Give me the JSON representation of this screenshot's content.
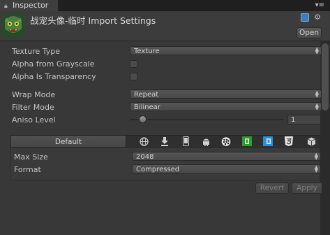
{
  "window": {
    "tab_title": "Inspector",
    "tab_menu_glyph": "▾≡"
  },
  "header": {
    "title": "战宠头像-临时 Import Settings",
    "open_label": "Open"
  },
  "fields": {
    "texture_type": {
      "label": "Texture Type",
      "value": "Texture"
    },
    "alpha_from_grayscale": {
      "label": "Alpha from Grayscale",
      "checked": false
    },
    "alpha_is_transparency": {
      "label": "Alpha Is Transparency",
      "checked": false
    },
    "wrap_mode": {
      "label": "Wrap Mode",
      "value": "Repeat"
    },
    "filter_mode": {
      "label": "Filter Mode",
      "value": "Bilinear"
    },
    "aniso_level": {
      "label": "Aniso Level",
      "value": "1",
      "slider_fraction": 0.06
    }
  },
  "platforms": {
    "default_label": "Default",
    "icons": [
      "web-globe-icon",
      "download-icon",
      "mobile-phone-icon",
      "android-icon",
      "blackberry-icon",
      "xbox-icon",
      "windows-store-icon",
      "html5-icon",
      "package-box-icon"
    ]
  },
  "platform_settings": {
    "max_size": {
      "label": "Max Size",
      "value": "2048"
    },
    "format": {
      "label": "Format",
      "value": "Compressed"
    }
  },
  "actions": {
    "revert_label": "Revert",
    "apply_label": "Apply"
  },
  "colors": {
    "background": "#383838",
    "tab_strip": "#1f1f1f",
    "accent_help": "#3b7bc9"
  }
}
